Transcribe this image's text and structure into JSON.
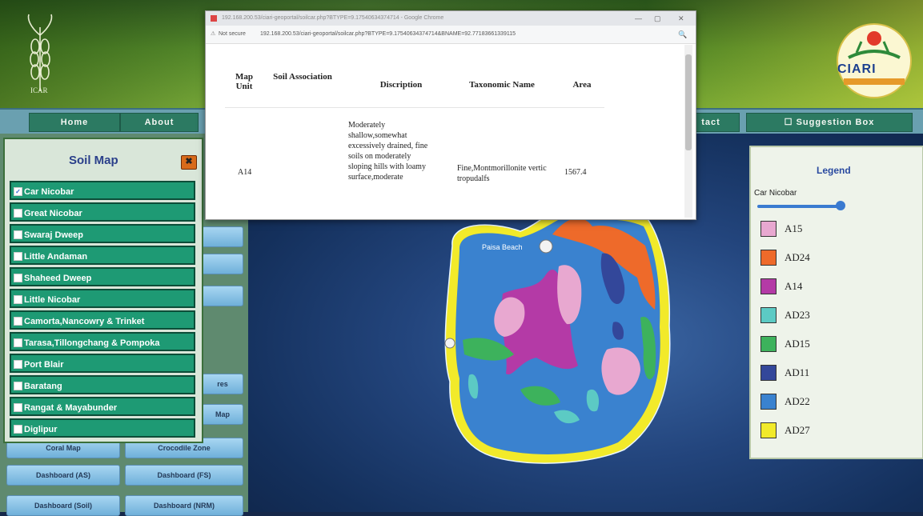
{
  "header": {
    "icar_caption": "ICAR",
    "ciari_label": "CIARI"
  },
  "nav": {
    "items": [
      "Home",
      "About",
      "tact",
      "☐ Suggestion Box"
    ]
  },
  "soil_panel": {
    "title": "Soil Map",
    "close_symbol": "✖",
    "items": [
      {
        "label": "Car Nicobar",
        "checked": true
      },
      {
        "label": "Great Nicobar",
        "checked": false
      },
      {
        "label": "Swaraj Dweep",
        "checked": false
      },
      {
        "label": "Little Andaman",
        "checked": false
      },
      {
        "label": "Shaheed Dweep",
        "checked": false
      },
      {
        "label": "Little Nicobar",
        "checked": false
      },
      {
        "label": "Camorta,Nancowry & Trinket",
        "checked": false
      },
      {
        "label": "Tarasa,Tillongchang & Pompoka",
        "checked": false
      },
      {
        "label": "Port Blair",
        "checked": false
      },
      {
        "label": "Baratang",
        "checked": false
      },
      {
        "label": "Rangat & Mayabunder",
        "checked": false
      },
      {
        "label": "Diglipur",
        "checked": false
      }
    ]
  },
  "bg_buttons": {
    "coral": "Coral Map",
    "crocodile": "Crocodile Zone",
    "dash_as": "Dashboard (AS)",
    "dash_fs": "Dashboard (FS)",
    "dash_soil": "Dashboard (Soil)",
    "dash_nrm": "Dashboard (NRM)",
    "res": "res",
    "map": "Map"
  },
  "popup": {
    "title": "192.168.200.53/ciari-geoportal/soilcar.php?BTYPE=9.17540634374714 - Google Chrome",
    "not_secure": "Not secure",
    "url": "192.168.200.53/ciari-geoportal/soilcar.php?BTYPE=9.17540634374714&BNAME=92.77183661339115",
    "headers": [
      "Map Unit",
      "Soil Association",
      "Discription",
      "Taxonomic Name",
      "Area"
    ],
    "row": {
      "map_unit": "A14",
      "soil_association": "",
      "description": "Moderately shallow,somewhat excessively drained, fine soils on moderately sloping hills with loamy surface,moderate",
      "taxonomic_name": "Fine,Montmorillonite vertic tropudalfs",
      "area": "1567.4"
    }
  },
  "map": {
    "place_label": "Paisa Beach"
  },
  "legend": {
    "title": "Legend",
    "layer": "Car Nicobar",
    "opacity": 1.0,
    "items": [
      {
        "label": "A15",
        "color": "#e8a8d0"
      },
      {
        "label": "AD24",
        "color": "#ee6a2a"
      },
      {
        "label": "A14",
        "color": "#b43aa6"
      },
      {
        "label": "AD23",
        "color": "#5ccac4"
      },
      {
        "label": "AD15",
        "color": "#3db25c"
      },
      {
        "label": "AD11",
        "color": "#33479a"
      },
      {
        "label": "AD22",
        "color": "#3a82cf"
      },
      {
        "label": "AD27",
        "color": "#f2ea2a"
      }
    ]
  }
}
